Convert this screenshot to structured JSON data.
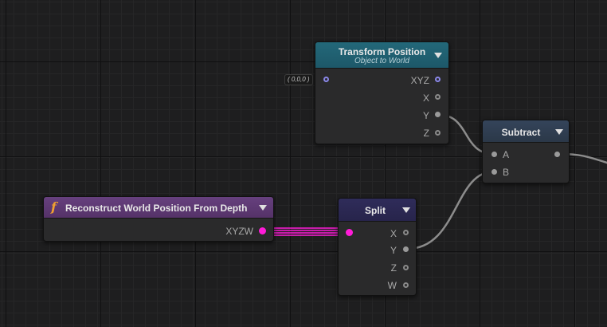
{
  "nodes": {
    "transform_position": {
      "title": "Transform Position",
      "subtitle": "Object to World",
      "default_value": "( 0,0,0 )",
      "outputs": [
        "XYZ",
        "X",
        "Y",
        "Z"
      ],
      "color": "#1d5b6c"
    },
    "subtract": {
      "title": "Subtract",
      "inputs": [
        "A",
        "B"
      ],
      "color": "#2d3a48"
    },
    "reconstruct": {
      "title": "Reconstruct World Position From Depth",
      "outputs": [
        "XYZW"
      ],
      "icon": "function-icon",
      "color": "#5a3572"
    },
    "split": {
      "title": "Split",
      "outputs": [
        "X",
        "Y",
        "Z",
        "W"
      ],
      "color": "#2b2851"
    }
  },
  "colors": {
    "wire_grey": "#8c8c8c",
    "wire_vec4": "#ff1bd8"
  }
}
